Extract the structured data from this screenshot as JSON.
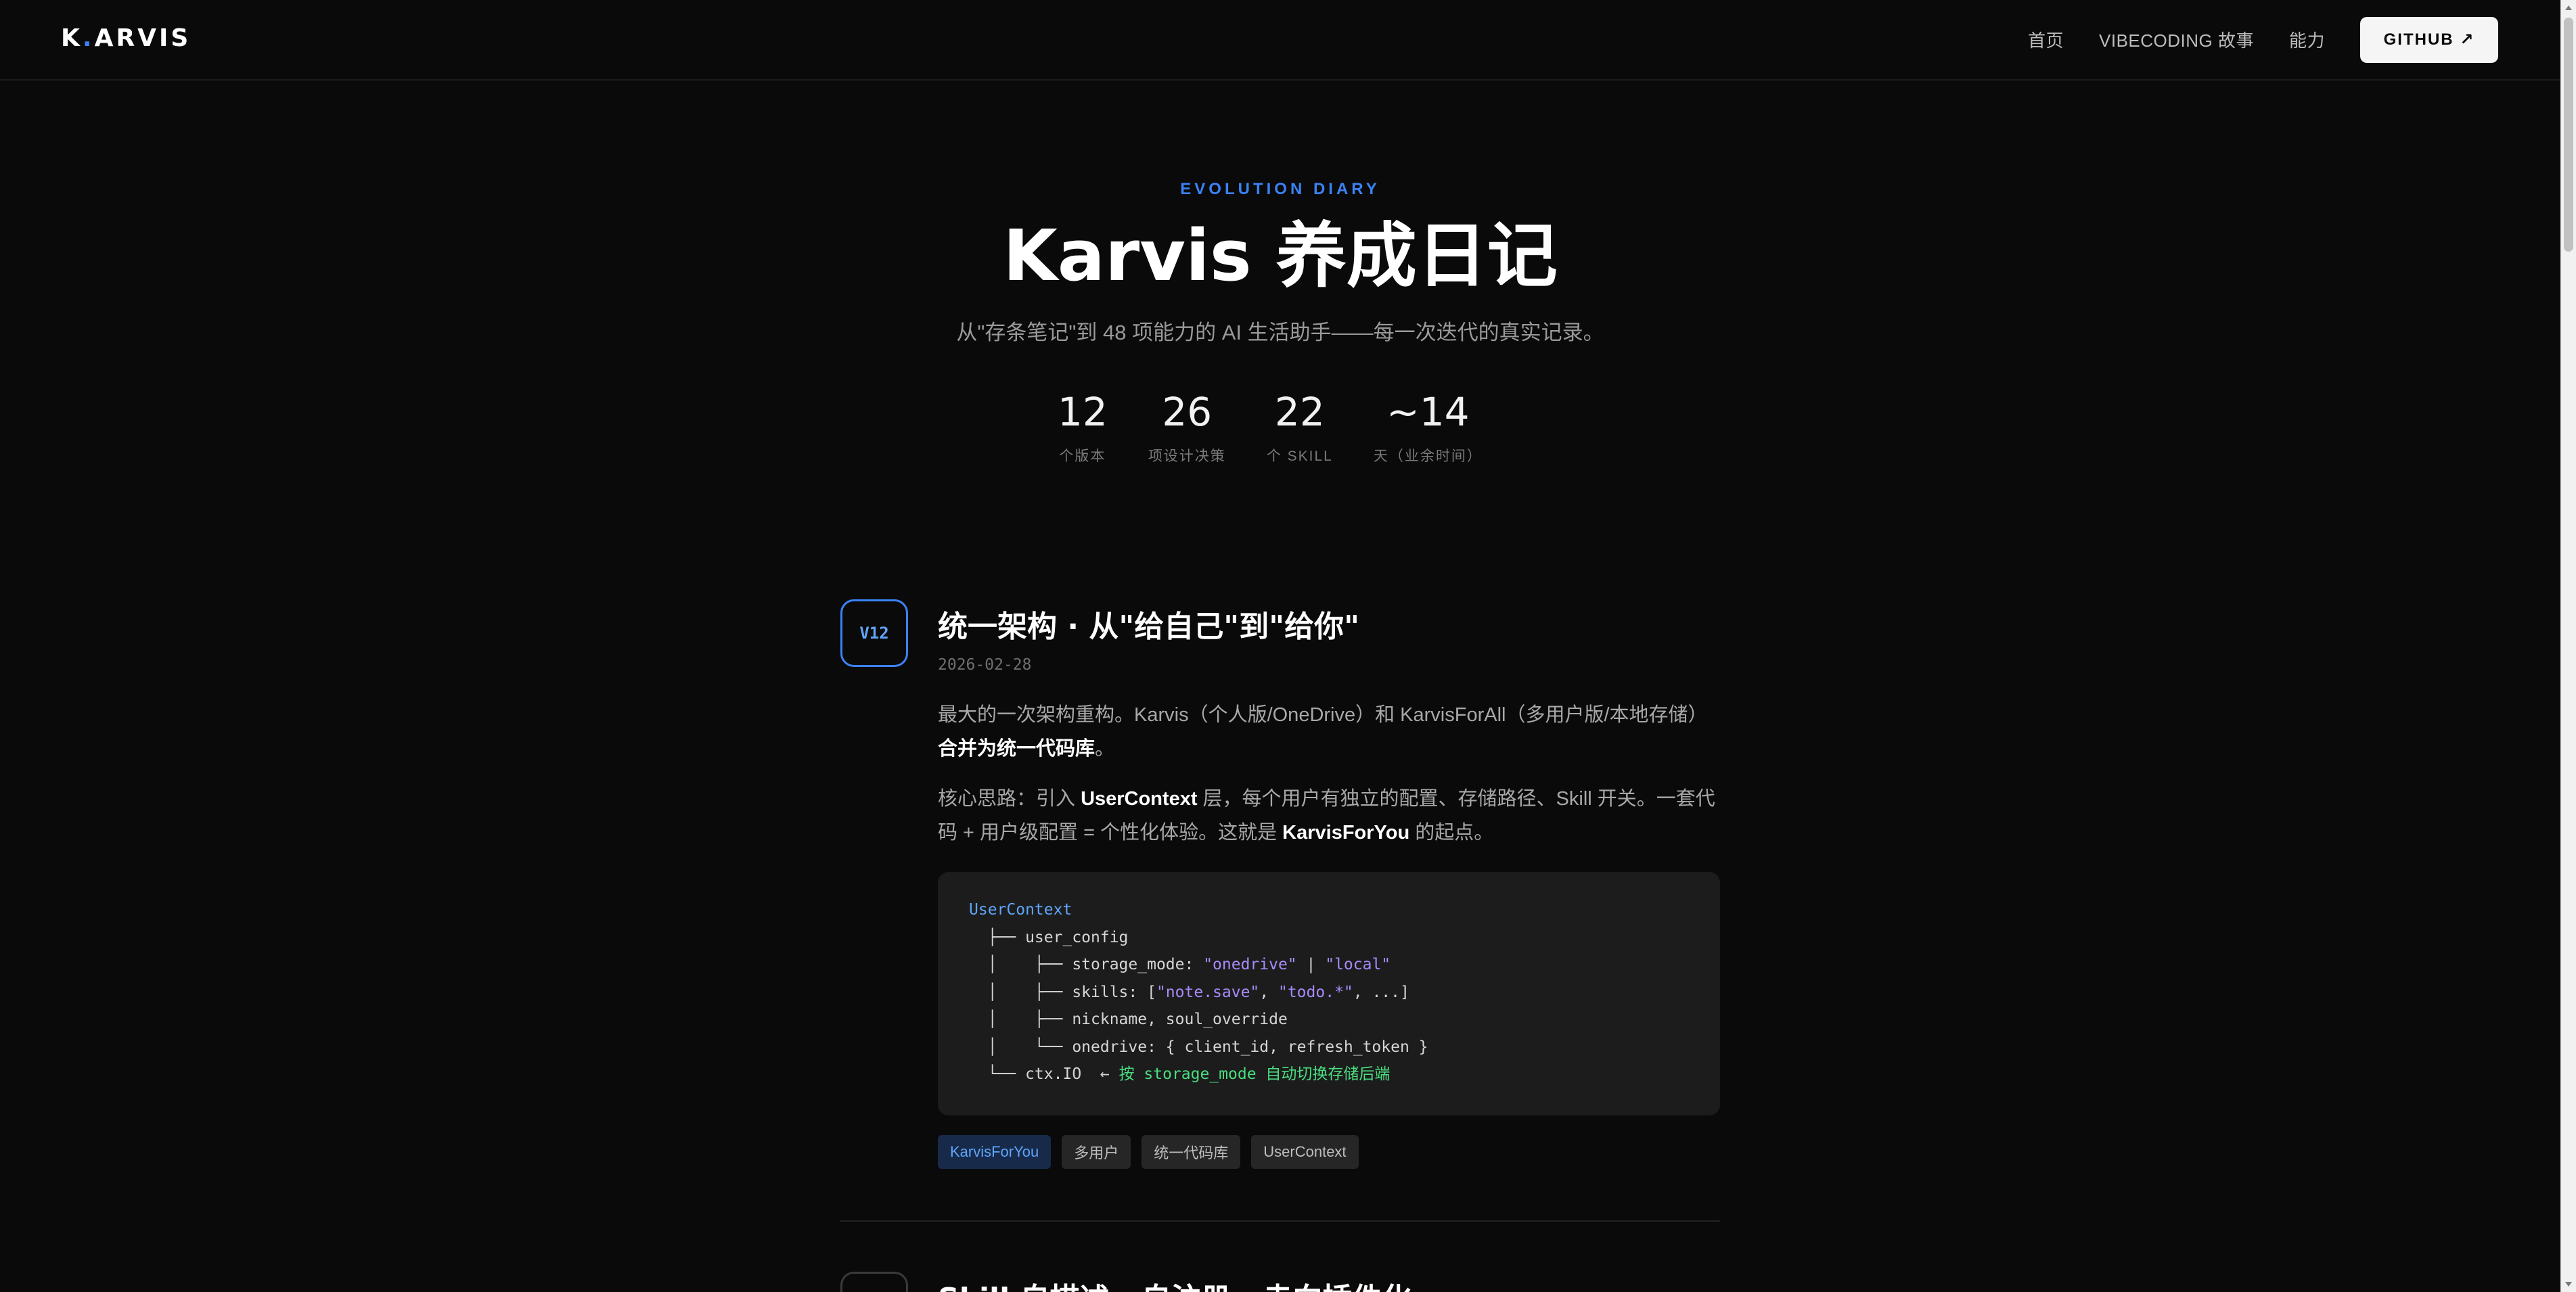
{
  "nav": {
    "logo": "K.ARVIS",
    "links": [
      "首页",
      "VIBECODING 故事",
      "能力"
    ],
    "github_label": "GITHUB ↗"
  },
  "hero": {
    "eyebrow": "EVOLUTION DIARY",
    "title": "Karvis 养成日记",
    "subtitle": "从\"存条笔记\"到 48 项能力的 AI 生活助手——每一次迭代的真实记录。",
    "stats": [
      {
        "value": "12",
        "label": "个版本"
      },
      {
        "value": "26",
        "label": "项设计决策"
      },
      {
        "value": "22",
        "label": "个 SKILL"
      },
      {
        "value": "~14",
        "label": "天（业余时间）"
      }
    ]
  },
  "entry": {
    "version": "V12",
    "title": "统一架构 · 从\"给自己\"到\"给你\"",
    "date": "2026-02-28",
    "p1": {
      "text": "最大的一次架构重构。Karvis（个人版/OneDrive）和 KarvisForAll（多用户版/本地存储）",
      "bold": "合并为统一代码库",
      "tail": "。"
    },
    "p2": {
      "t1": "核心思路：引入 ",
      "b1": "UserContext",
      "t2": " 层，每个用户有独立的配置、存储路径、Skill 开关。一套代码 + 用户级配置 = 个性化体验。这就是 ",
      "b2": "KarvisForYou",
      "t3": " 的起点。"
    },
    "code": {
      "root": "UserContext",
      "l1": "  ├── user_config",
      "l2a": "  │    ├── storage_mode: ",
      "l2b": "\"onedrive\"",
      "l2c": " | ",
      "l2d": "\"local\"",
      "l3a": "  │    ├── skills: [",
      "l3b": "\"note.save\"",
      "l3c": ", ",
      "l3d": "\"todo.*\"",
      "l3e": ", ...]",
      "l4": "  │    ├── nickname, soul_override",
      "l5": "  │    └── onedrive: { client_id, refresh_token }",
      "l6a": "  └── ctx.IO  ← ",
      "l6b": "按 storage_mode 自动切换存储后端"
    },
    "tags": [
      "KarvisForYou",
      "多用户",
      "统一代码库",
      "UserContext"
    ]
  },
  "next_entry": {
    "title": "Skill 自描述 · 自注册 · 走向插件化"
  },
  "colors": {
    "accent": "#3b82f6",
    "background": "#0a0a0a",
    "code_bg": "#1c1c1c"
  }
}
